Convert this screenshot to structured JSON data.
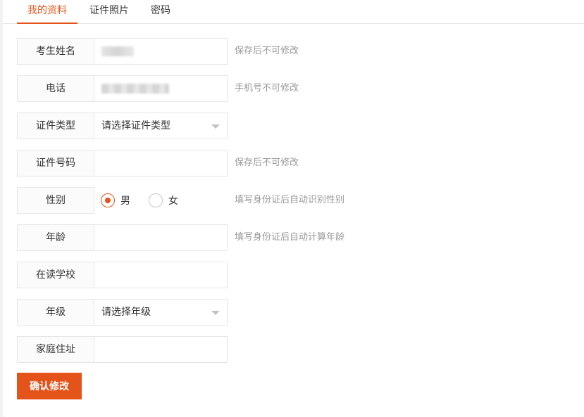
{
  "tabs": [
    "我的资料",
    "证件照片",
    "密码"
  ],
  "form": {
    "name_label": "考生姓名",
    "name_hint": "保存后不可修改",
    "phone_label": "电话",
    "phone_hint": "手机号不可修改",
    "idtype_label": "证件类型",
    "idtype_value": "请选择证件类型",
    "idno_label": "证件号码",
    "idno_hint": "保存后不可修改",
    "gender_label": "性别",
    "gender_options": [
      "男",
      "女"
    ],
    "gender_selected": "男",
    "gender_hint": "填写身份证后自动识别性别",
    "age_label": "年龄",
    "age_hint": "填写身份证后自动计算年龄",
    "school_label": "在读学校",
    "grade_label": "年级",
    "grade_value": "请选择年级",
    "address_label": "家庭住址"
  },
  "submit_label": "确认修改",
  "colors": {
    "accent": "#e4541a",
    "border": "#e6e6e6",
    "hint": "#999999"
  }
}
